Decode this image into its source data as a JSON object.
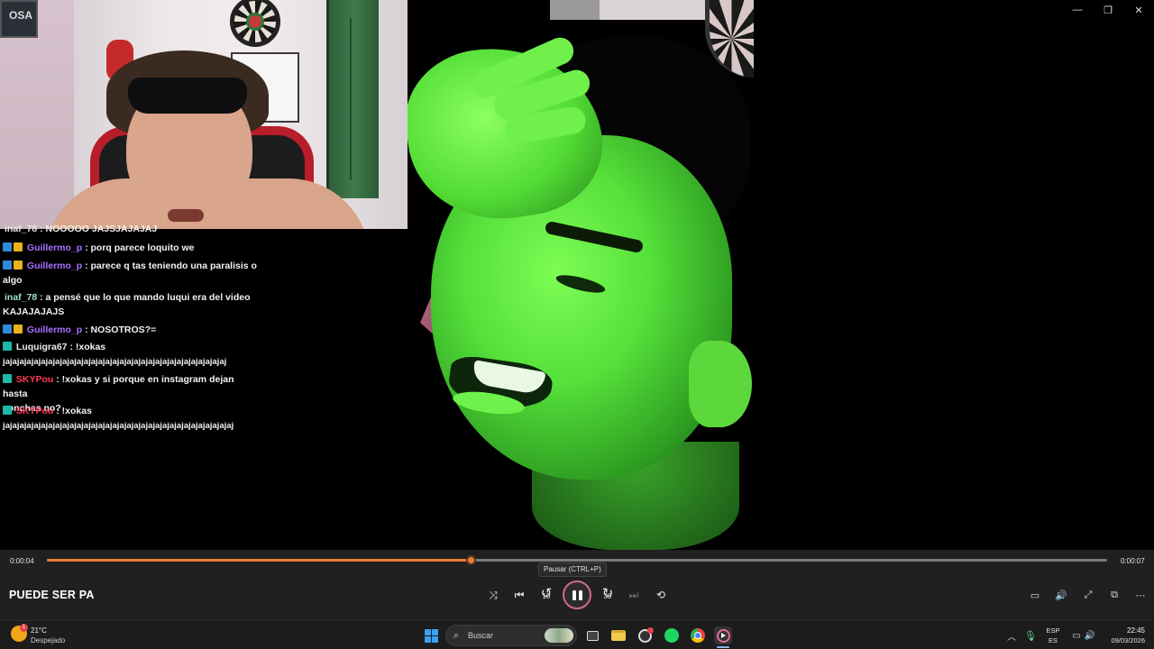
{
  "window": {
    "minimize": "—",
    "maximize": "❐",
    "close": "✕"
  },
  "stream_preview": {
    "poster_text": "OSA"
  },
  "chat": [
    {
      "user": "inaf_78",
      "message": ": NOOOOO JAJSJAJAJAJ",
      "color": "white",
      "badges": []
    },
    {
      "user": "Guillermo_p",
      "message": ": porq parece loquito we",
      "color": "purple",
      "badges": [
        "blue",
        "gold"
      ]
    },
    {
      "user": "Guillermo_p",
      "message": ": parece q tas teniendo una paralisis o",
      "message_cont": "algo",
      "color": "purple",
      "badges": [
        "blue",
        "gold"
      ]
    },
    {
      "user": "inaf_78",
      "message": ": a pensé que lo que mando luqui era del video",
      "message_cont": "KAJAJAJAJS",
      "color": "green",
      "badges": []
    },
    {
      "user": "Guillermo_p",
      "message": ": NOSOTROS?=",
      "color": "purple",
      "badges": [
        "blue",
        "gold"
      ]
    },
    {
      "user": "Luquigra67",
      "message": ": !xokas",
      "message_cont": "jajajajajajajajajajajajajajajajajajajajajajajajajajajajajajajaj",
      "color": "white",
      "badges": [
        "teal"
      ]
    },
    {
      "user": "SKYPou",
      "message": ": !xokas y si porque en instagram dejan hasta",
      "message_cont": "conchas no?",
      "color": "red",
      "badges": [
        "teal"
      ]
    },
    {
      "user": "SKYPou",
      "message": ": !xokas",
      "message_cont": "jajajajajajajajajajajajajajajajajajajajajajajajajajajajajajajajaj",
      "color": "red",
      "badges": [
        "teal"
      ]
    }
  ],
  "player": {
    "current_time": "0:00:04",
    "total_time": "0:00:07",
    "progress": 0.4,
    "title": "PUEDE SER PA",
    "tooltip": "Pausar (CTRL+P)",
    "accent_color": "#ec7a3a",
    "controls": {
      "shuffle_icon": "⤨",
      "previous_icon": "⏮",
      "rewind_label": "10",
      "forward_label": "30",
      "next_icon": "⏭",
      "repeat_icon": "⟲"
    },
    "right_controls": {
      "subtitles_icon": "▭",
      "volume_icon": "🔊",
      "fullscreen_icon": "⤢",
      "miniplayer_icon": "⧉",
      "more_icon": "⋯"
    }
  },
  "taskbar": {
    "weather_temp": "21°C",
    "weather_desc": "Despejado",
    "weather_alert": "1",
    "search_placeholder": "Buscar",
    "language_top": "ESP",
    "language_bottom": "ES",
    "time": "22:45",
    "date": "09/03/2026"
  }
}
